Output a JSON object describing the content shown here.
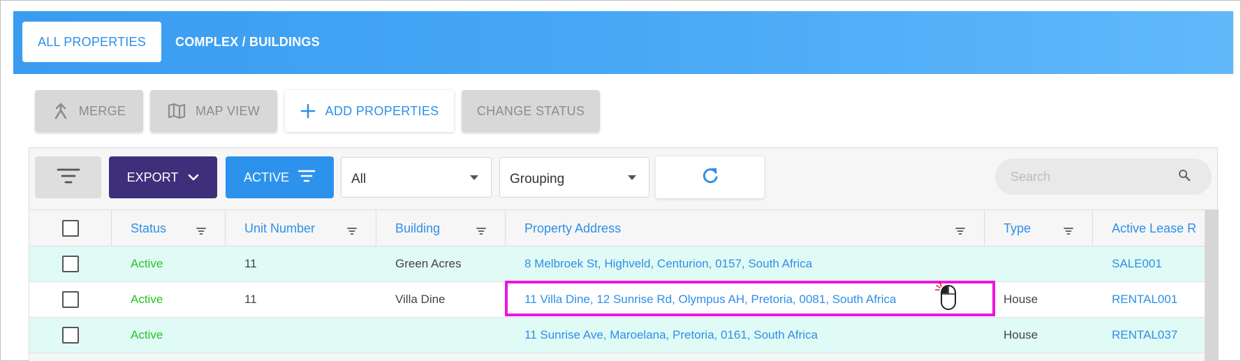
{
  "tabs": {
    "all_properties": "ALL PROPERTIES",
    "complex_buildings": "COMPLEX / BUILDINGS"
  },
  "actions": {
    "merge": "MERGE",
    "map_view": "MAP VIEW",
    "add_properties": "ADD PROPERTIES",
    "change_status": "CHANGE STATUS"
  },
  "toolbar": {
    "export": "EXPORT",
    "active": "ACTIVE",
    "filter_select": "All",
    "grouping_select": "Grouping",
    "search_placeholder": "Search"
  },
  "columns": {
    "status": "Status",
    "unit_number": "Unit Number",
    "building": "Building",
    "property_address": "Property Address",
    "type": "Type",
    "active_lease": "Active Lease R"
  },
  "rows": [
    {
      "status": "Active",
      "unit": "11",
      "building": "Green Acres",
      "address": "8 Melbroek St, Highveld, Centurion, 0157, South Africa",
      "type": "",
      "lease": "SALE001"
    },
    {
      "status": "Active",
      "unit": "11",
      "building": "Villa Dine",
      "address": "11 Villa Dine, 12 Sunrise Rd, Olympus AH, Pretoria, 0081, South Africa",
      "type": "House",
      "lease": "RENTAL001"
    },
    {
      "status": "Active",
      "unit": "",
      "building": "",
      "address": "11 Sunrise Ave, Maroelana, Pretoria, 0161, South Africa",
      "type": "House",
      "lease": "RENTAL037"
    }
  ],
  "colors": {
    "brand_blue": "#2e8fe8",
    "export_purple": "#3f2f7a",
    "status_green": "#27c427",
    "row_alt": "#e0faf6",
    "highlight": "#ee14de"
  },
  "icons": {
    "merge": "merge-icon",
    "map": "map-icon",
    "add": "plus-icon",
    "filter": "filter-icon",
    "chevron": "chevron-down-icon",
    "refresh": "refresh-icon",
    "search": "search-icon",
    "cursor": "mouse-click-icon"
  }
}
